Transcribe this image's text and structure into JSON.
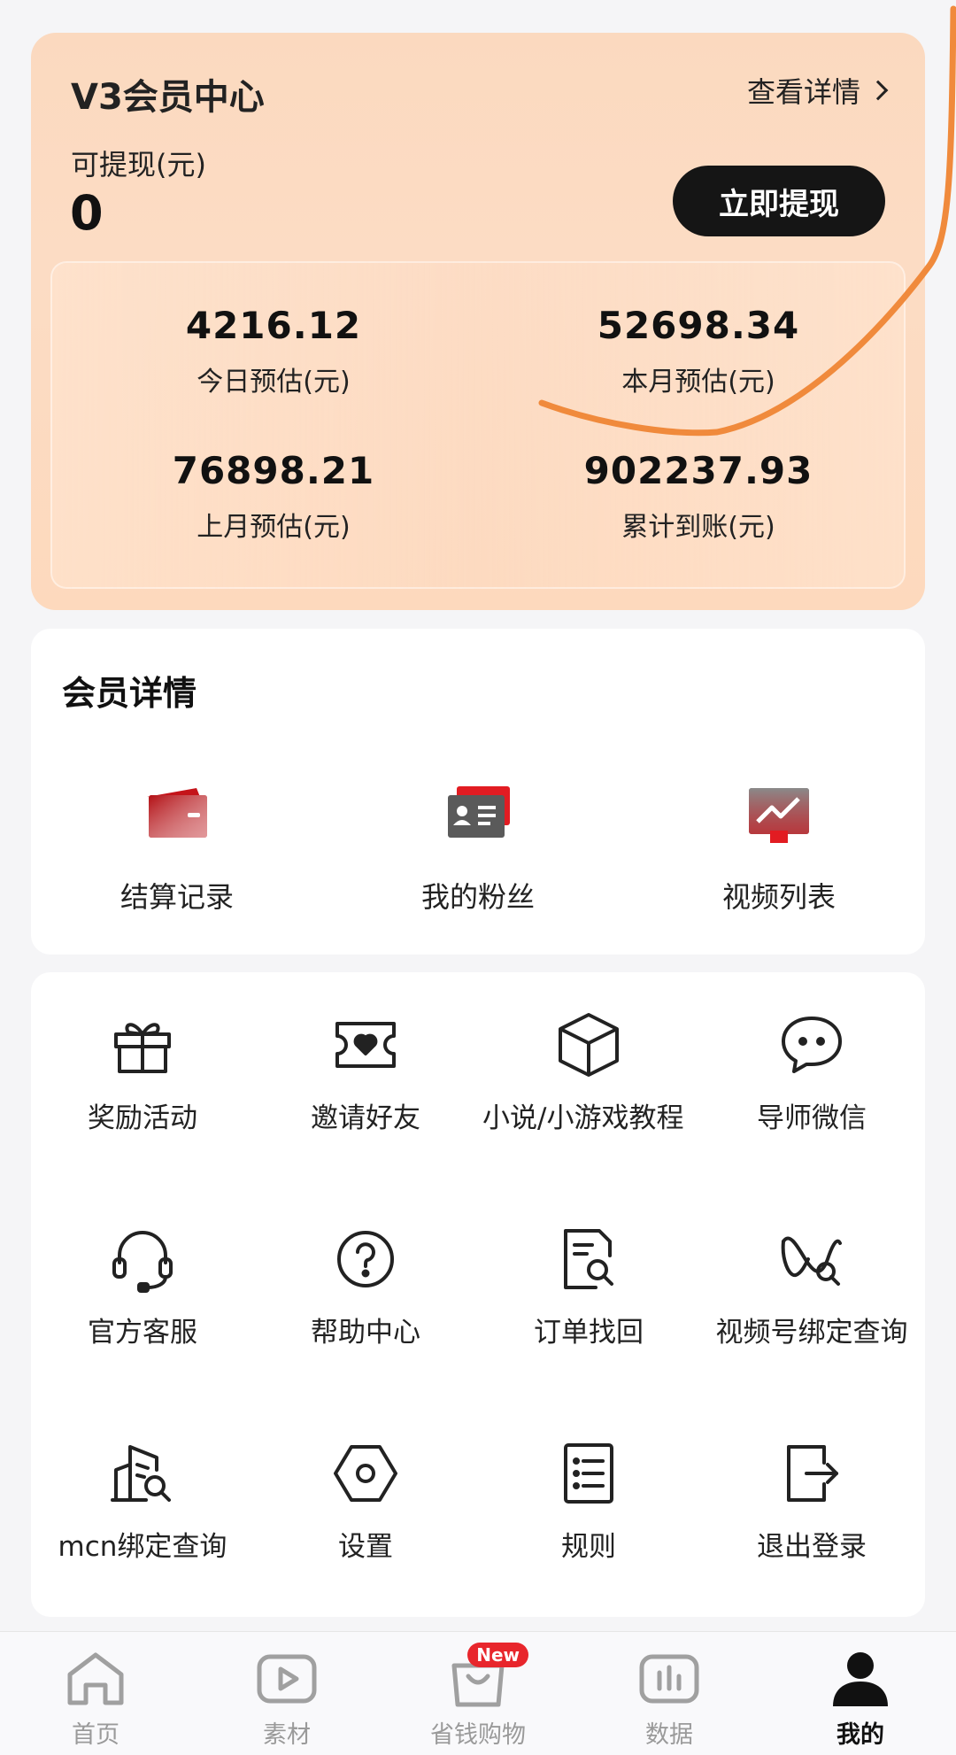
{
  "member_card": {
    "title": "V3会员中心",
    "details_link": "查看详情",
    "withdrawable_label": "可提现(元)",
    "withdrawable_amount": "0",
    "withdraw_button": "立即提现",
    "stats": [
      {
        "value": "4216.12",
        "label": "今日预估(元)"
      },
      {
        "value": "52698.34",
        "label": "本月预估(元)"
      },
      {
        "value": "76898.21",
        "label": "上月预估(元)"
      },
      {
        "value": "902237.93",
        "label": "累计到账(元)"
      }
    ]
  },
  "member_details": {
    "title": "会员详情",
    "items": [
      {
        "label": "结算记录",
        "icon": "wallet-icon"
      },
      {
        "label": "我的粉丝",
        "icon": "id-card-icon"
      },
      {
        "label": "视频列表",
        "icon": "trend-chart-icon"
      }
    ]
  },
  "tools": [
    {
      "label": "奖励活动",
      "icon": "gift-icon"
    },
    {
      "label": "邀请好友",
      "icon": "ticket-heart-icon"
    },
    {
      "label": "小说/小游戏教程",
      "icon": "cube-icon"
    },
    {
      "label": "导师微信",
      "icon": "chat-icon"
    },
    {
      "label": "官方客服",
      "icon": "headset-icon"
    },
    {
      "label": "帮助中心",
      "icon": "help-icon"
    },
    {
      "label": "订单找回",
      "icon": "document-search-icon"
    },
    {
      "label": "视频号绑定查询",
      "icon": "channels-search-icon"
    },
    {
      "label": "mcn绑定查询",
      "icon": "building-search-icon"
    },
    {
      "label": "设置",
      "icon": "settings-hexagon-icon"
    },
    {
      "label": "规则",
      "icon": "list-document-icon"
    },
    {
      "label": "退出登录",
      "icon": "logout-icon"
    }
  ],
  "bottom_nav": {
    "items": [
      {
        "label": "首页",
        "icon": "home-icon"
      },
      {
        "label": "素材",
        "icon": "play-icon"
      },
      {
        "label": "省钱购物",
        "icon": "shopping-bag-icon",
        "badge": "New"
      },
      {
        "label": "数据",
        "icon": "bar-chart-icon"
      },
      {
        "label": "我的",
        "icon": "person-icon",
        "active": true
      }
    ]
  },
  "colors": {
    "accent_red": "#e8262c",
    "card_peach": "#fbd9bf",
    "annotation_orange": "#f08a3c",
    "dark_button": "#151515"
  }
}
